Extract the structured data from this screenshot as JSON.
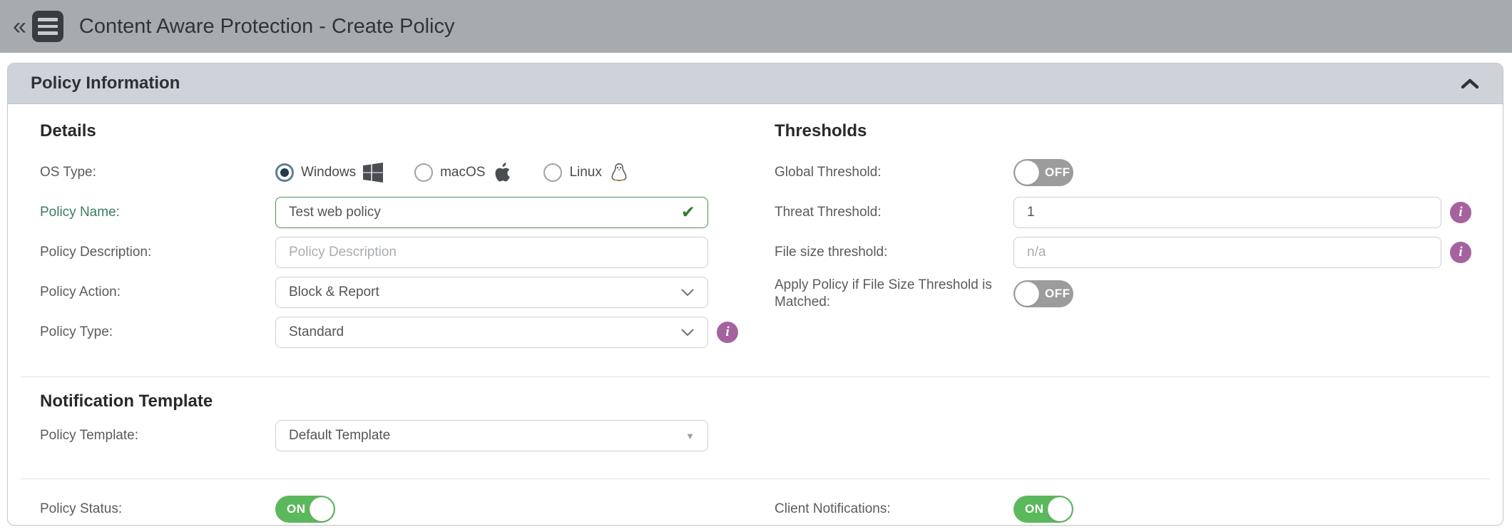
{
  "header": {
    "back_glyph": "«",
    "title": "Content Aware Protection - Create Policy"
  },
  "panel": {
    "title": "Policy Information"
  },
  "icons": {
    "dropdown_triangle": "▼",
    "checkmark": "✔",
    "info": "i"
  },
  "details": {
    "heading": "Details",
    "os_type_label": "OS Type:",
    "os_options": [
      {
        "label": "Windows",
        "selected": true
      },
      {
        "label": "macOS",
        "selected": false
      },
      {
        "label": "Linux",
        "selected": false
      }
    ],
    "policy_name_label": "Policy Name:",
    "policy_name_value": "Test web policy",
    "policy_description_label": "Policy Description:",
    "policy_description_placeholder": "Policy Description",
    "policy_action_label": "Policy Action:",
    "policy_action_value": "Block & Report",
    "policy_type_label": "Policy Type:",
    "policy_type_value": "Standard"
  },
  "thresholds": {
    "heading": "Thresholds",
    "global_threshold_label": "Global Threshold:",
    "global_threshold_state": "OFF",
    "threat_threshold_label": "Threat Threshold:",
    "threat_threshold_value": "1",
    "file_size_threshold_label": "File size threshold:",
    "file_size_threshold_placeholder": "n/a",
    "apply_policy_label": "Apply Policy if File Size Threshold is Matched:",
    "apply_policy_state": "OFF"
  },
  "notification": {
    "heading": "Notification Template",
    "policy_template_label": "Policy Template:",
    "policy_template_value": "Default Template"
  },
  "status": {
    "policy_status_label": "Policy Status:",
    "policy_status_state": "ON",
    "client_notifications_label": "Client Notifications:",
    "client_notifications_state": "ON"
  },
  "colors": {
    "toggle_on_green": "#5cb85c",
    "toggle_off_gray": "#9c9c9c",
    "info_badge_purple": "#a4639e",
    "valid_field_green": "#4c9150",
    "topbar_gray": "#a8abae",
    "panel_header_gray": "#ced3d9"
  }
}
